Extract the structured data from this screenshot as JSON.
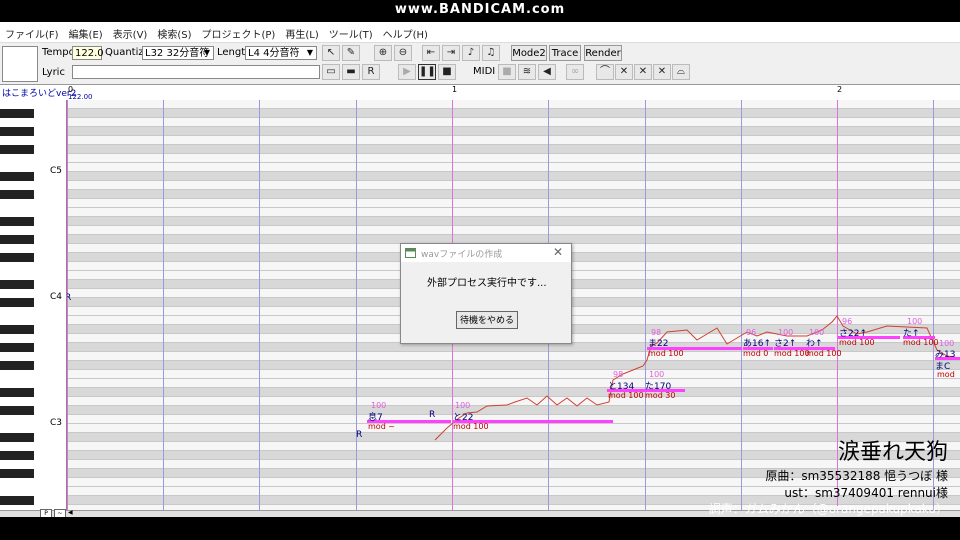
{
  "watermark": "www.BANDICAM.com",
  "menu": [
    "ファイル(F)",
    "編集(E)",
    "表示(V)",
    "検索(S)",
    "プロジェクト(P)",
    "再生(L)",
    "ツール(T)",
    "ヘルプ(H)"
  ],
  "toolbar": {
    "tempo_label": "Tempo",
    "tempo_value": "122.0",
    "quantize_label": "Quantize",
    "quantize_value": "L32 32分音符",
    "length_label": "Length",
    "length_value": "L4 4分音符",
    "lyric_label": "Lyric",
    "mode2": "Mode2",
    "trace": "Trace",
    "render": "Render",
    "midi": "MIDI"
  },
  "track": {
    "name": "はこまろいどver2",
    "bar0": "0",
    "bar1": "1",
    "bar2": "2",
    "tempo_mark": "122.00"
  },
  "keys": {
    "c5": "C5",
    "c4": "C4",
    "c3": "C3"
  },
  "notes": [
    {
      "lyric": "息7",
      "vel": "100",
      "mod": "mod ~"
    },
    {
      "lyric": "R",
      "vel": "",
      "mod": ""
    },
    {
      "lyric": "と22",
      "vel": "100",
      "mod": "mod 100"
    },
    {
      "lyric": "と134",
      "vel": "98",
      "mod": "mod 100"
    },
    {
      "lyric": "た170",
      "vel": "100",
      "mod": "mod 30"
    },
    {
      "lyric": "ま22",
      "vel": "98",
      "mod": "mod 100"
    },
    {
      "lyric": "あ16↑",
      "vel": "96",
      "mod": "mod 0"
    },
    {
      "lyric": "さ2↑",
      "vel": "100",
      "mod": "mod 100"
    },
    {
      "lyric": "わ↑",
      "vel": "100",
      "mod": "mod 100"
    },
    {
      "lyric": "さ22↑",
      "vel": "96",
      "mod": "mod 100"
    },
    {
      "lyric": "た↑",
      "vel": "100",
      "mod": "mod 100"
    },
    {
      "lyric": "み13",
      "vel": "100",
      "mod": ""
    },
    {
      "lyric": "まC",
      "vel": "",
      "mod": "mod"
    }
  ],
  "r_marks": [
    "R",
    "R"
  ],
  "dialog": {
    "title": "wavファイルの作成",
    "message": "外部プロセス実行中です...",
    "cancel": "待機をやめる"
  },
  "credits": {
    "title": "涙垂れ天狗",
    "line1": "原曲：sm35532188 悒うつぼ 様",
    "line2": "ust：sm37409401 rennui様",
    "line3": "調声：ガムみかん（@orangepakupkaku）"
  }
}
